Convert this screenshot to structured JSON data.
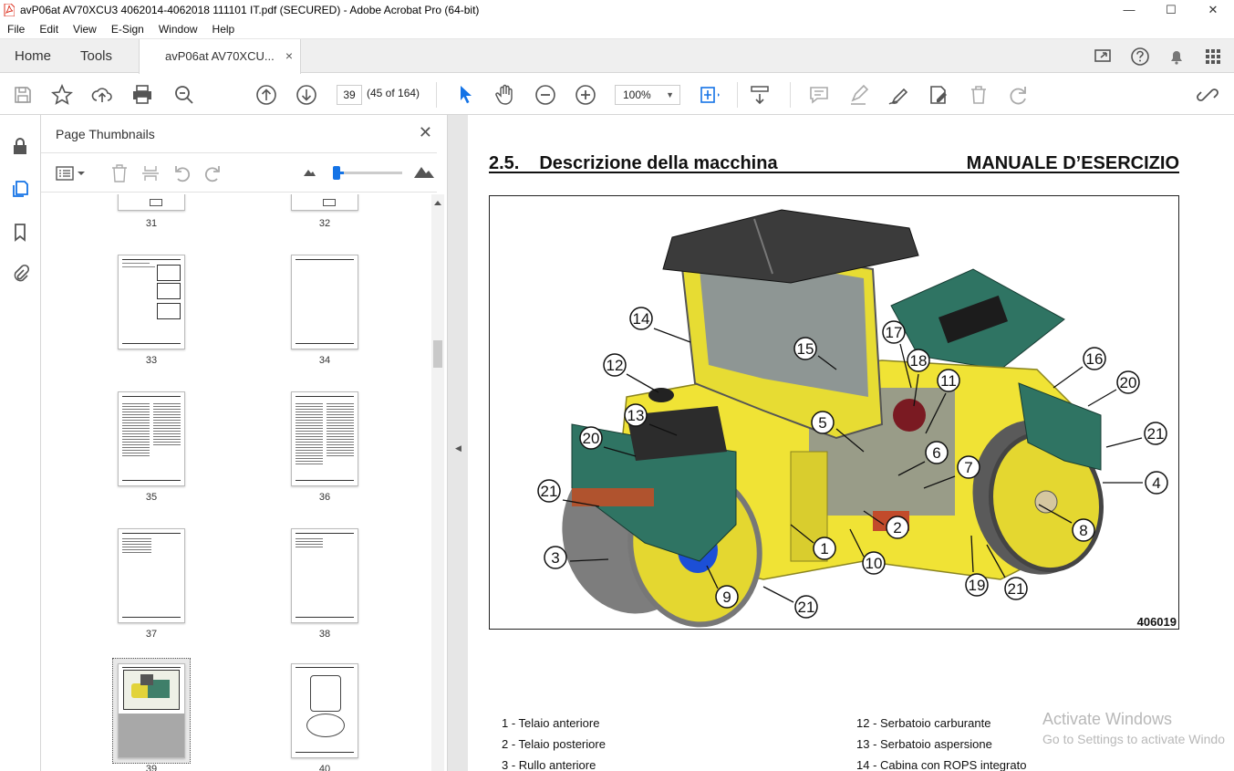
{
  "window": {
    "title": "avP06at AV70XCU3 4062014-4062018 111101 IT.pdf (SECURED) - Adobe Acrobat Pro (64-bit)",
    "minimize": "—",
    "maximize": "☐",
    "close": "✕"
  },
  "menu": [
    "File",
    "Edit",
    "View",
    "E-Sign",
    "Window",
    "Help"
  ],
  "tabs": {
    "home": "Home",
    "tools": "Tools",
    "document": "avP06at AV70XCU...",
    "close": "×"
  },
  "toolbar": {
    "page_number": "39",
    "page_count": "(45 of 164)",
    "zoom": "100%"
  },
  "panel": {
    "title": "Page Thumbnails",
    "close": "✕"
  },
  "thumbnails": [
    {
      "label": "31"
    },
    {
      "label": "32"
    },
    {
      "label": "33"
    },
    {
      "label": "34"
    },
    {
      "label": "35"
    },
    {
      "label": "36"
    },
    {
      "label": "37"
    },
    {
      "label": "38"
    },
    {
      "label": "39"
    },
    {
      "label": "40"
    }
  ],
  "document": {
    "section_number": "2.5.",
    "section_title": "Descrizione della macchina",
    "manual_title": "MANUALE D’ESERCIZIO",
    "figure_code": "406019",
    "callouts": [
      "14",
      "15",
      "12",
      "13",
      "20",
      "21",
      "3",
      "9",
      "21",
      "1",
      "10",
      "2",
      "5",
      "17",
      "18",
      "11",
      "6",
      "7",
      "16",
      "20",
      "21",
      "4",
      "8",
      "19",
      "21"
    ],
    "legend_left": [
      "1 - Telaio anteriore",
      "2 - Telaio posteriore",
      "3 - Rullo anteriore"
    ],
    "legend_right": [
      "12 - Serbatoio carburante",
      "13 - Serbatoio aspersione",
      "14 - Cabina con ROPS integrato"
    ]
  },
  "watermark": {
    "line1": "Activate Windows",
    "line2": "Go to Settings to activate Windo"
  }
}
